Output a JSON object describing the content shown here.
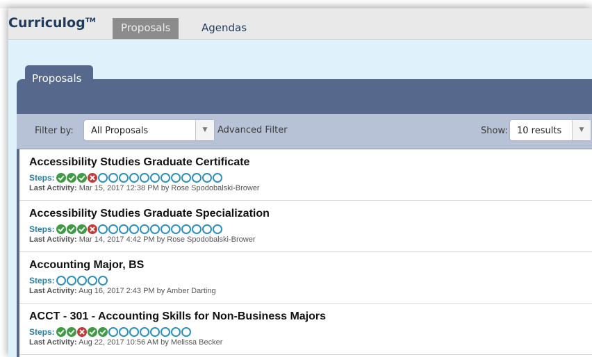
{
  "app": {
    "brand": "Curriculog",
    "trademark": "TM",
    "nav": [
      {
        "label": "Proposals",
        "active": true
      },
      {
        "label": "Agendas",
        "active": false
      }
    ]
  },
  "panel": {
    "tab_label": "Proposals"
  },
  "filter": {
    "filter_label": "Filter by:",
    "filter_value": "All Proposals",
    "advanced_label": "Advanced Filter",
    "show_label": "Show:",
    "show_value": "10 results"
  },
  "proposals": [
    {
      "title": "Accessibility Studies Graduate Certificate",
      "steps_label": "Steps:",
      "steps": [
        "done",
        "done",
        "done",
        "fail",
        "open",
        "open",
        "open",
        "open",
        "open",
        "open",
        "open",
        "open",
        "open",
        "open",
        "open",
        "open"
      ],
      "activity_label": "Last Activity:",
      "activity": "Mar 15, 2017 12:38 PM by Rose Spodobalski-Brower"
    },
    {
      "title": "Accessibility Studies Graduate Specialization",
      "steps_label": "Steps:",
      "steps": [
        "done",
        "done",
        "done",
        "fail",
        "open",
        "open",
        "open",
        "open",
        "open",
        "open",
        "open",
        "open",
        "open",
        "open",
        "open",
        "open"
      ],
      "activity_label": "Last Activity:",
      "activity": "Mar 14, 2017 4:42 PM by Rose Spodobalski-Brower"
    },
    {
      "title": "Accounting Major, BS",
      "steps_label": "Steps:",
      "steps": [
        "open",
        "open",
        "open",
        "open",
        "open"
      ],
      "activity_label": "Last Activity:",
      "activity": "Aug 16, 2017 2:43 PM by Amber Darting"
    },
    {
      "title": "ACCT - 301 - Accounting Skills for Non-Business Majors",
      "steps_label": "Steps:",
      "steps": [
        "done",
        "done",
        "fail",
        "done",
        "done",
        "open",
        "open",
        "open",
        "open",
        "open",
        "open",
        "open",
        "open"
      ],
      "activity_label": "Last Activity:",
      "activity": "Aug 22, 2017 10:56 AM by Melissa Becker"
    }
  ],
  "colors": {
    "accent": "#56688c",
    "step_done": "#3f9b44",
    "step_fail": "#c33a3a",
    "step_open": "#2b8fc0"
  }
}
